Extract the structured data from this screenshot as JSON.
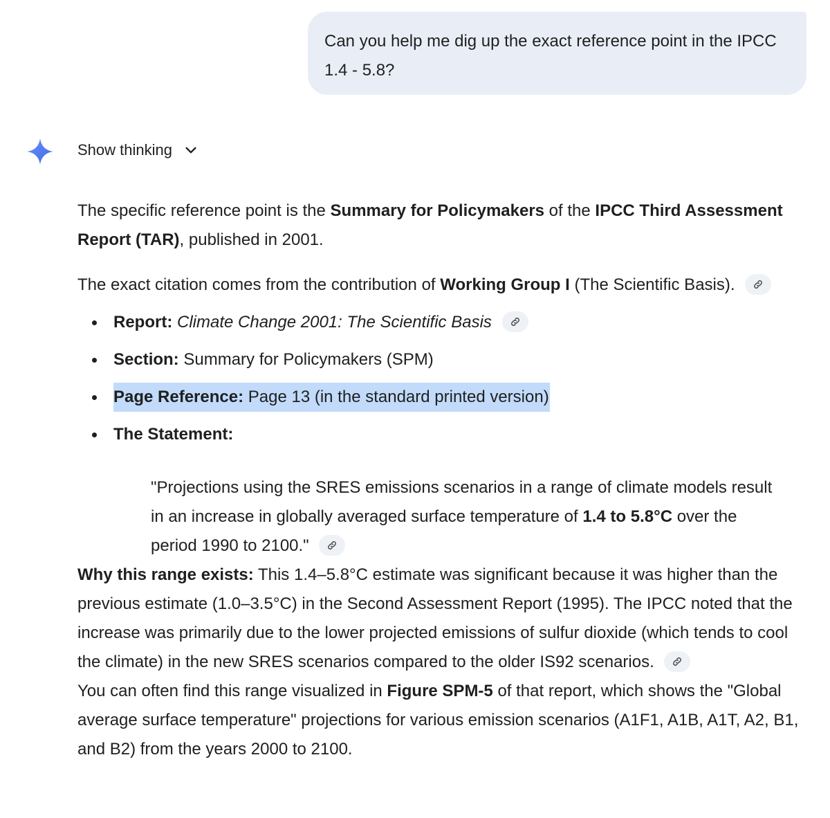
{
  "user_message": {
    "line1": "Can you help me dig up the exact reference point in the IPCC",
    "line2": "1.4 - 5.8?"
  },
  "thinking": {
    "label": "Show thinking"
  },
  "response": {
    "p1": {
      "t1": "The specific reference point is the ",
      "b1": "Summary for Policymakers",
      "t2": " of the ",
      "b2": "IPCC Third Assessment Report (TAR)",
      "t3": ", published in 2001."
    },
    "p2": {
      "t1": "The exact citation comes from the contribution of ",
      "b1": "Working Group I",
      "t2": " (The Scientific Basis)."
    },
    "bullets": [
      {
        "label": "Report:",
        "value": "Climate Change 2001: The Scientific Basis"
      },
      {
        "label": "Section:",
        "value": " Summary for Policymakers (SPM)"
      },
      {
        "label": "Page Reference:",
        "value": " Page 13 (in the standard printed version)"
      },
      {
        "label": "The Statement:",
        "value": ""
      }
    ],
    "quote": {
      "t1": "\"Projections using the SRES emissions scenarios in a range of climate models result in an increase in globally averaged surface temperature of ",
      "b1": "1.4 to 5.8°C",
      "t2": " over the period 1990 to 2100.\""
    },
    "why": {
      "b1": "Why this range exists:",
      "t1": " This 1.4–5.8°C estimate was significant because it was higher than the previous estimate (1.0–3.5°C) in the Second Assessment Report (1995). The IPCC noted that the increase was primarily due to the lower projected emissions of sulfur dioxide (which tends to cool the climate) in the new SRES scenarios compared to the older IS92 scenarios."
    },
    "last": {
      "t1": "You can often find this range visualized in ",
      "b1": "Figure SPM-5",
      "t2": " of that report, which shows the \"Global average surface temperature\" projections for various emission scenarios (A1F1, A1B, A1T, A2, B1, and B2) from the years 2000 to 2100."
    }
  },
  "colors": {
    "user_bubble": "#e9eef6",
    "highlight": "#c2dbfb",
    "link_chip": "#eef1f6",
    "spark_blue": "#4285f4"
  },
  "icons": [
    "gemini-spark-icon",
    "chevron-down-icon",
    "link-icon"
  ]
}
